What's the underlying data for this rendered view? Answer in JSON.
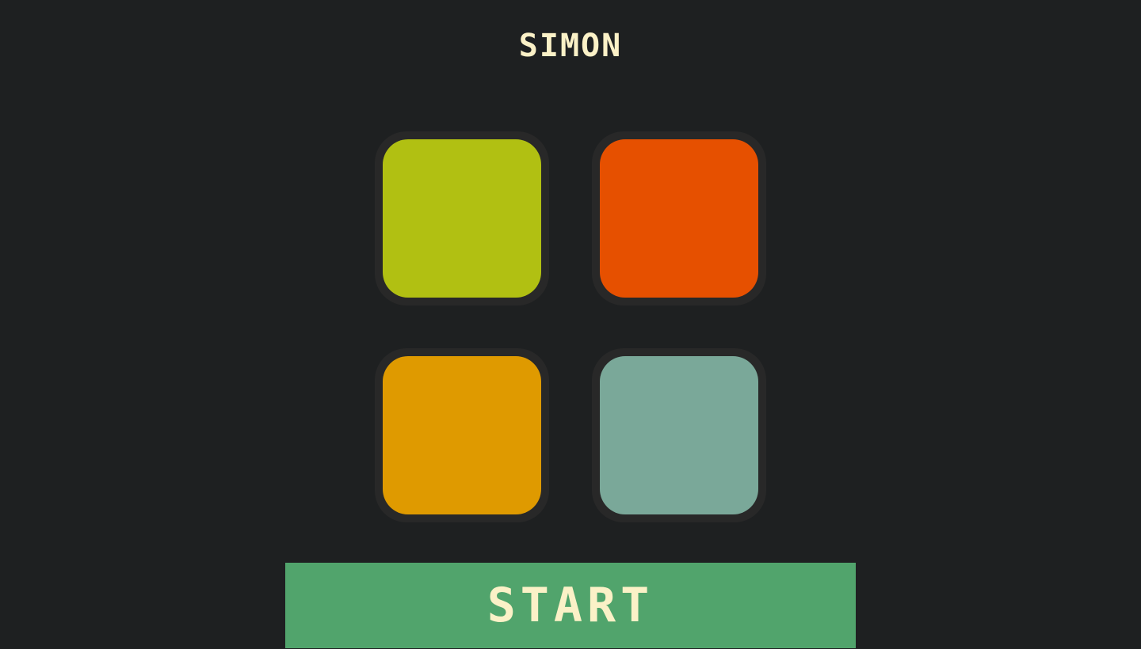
{
  "title": "SIMON",
  "pads": [
    {
      "name": "green-yellow-pad",
      "color": "#b1c012"
    },
    {
      "name": "orange-red-pad",
      "color": "#e65000"
    },
    {
      "name": "amber-pad",
      "color": "#df9a00"
    },
    {
      "name": "teal-pad",
      "color": "#7aa899"
    }
  ],
  "start_button": {
    "label": "START",
    "color": "#51a46c"
  }
}
